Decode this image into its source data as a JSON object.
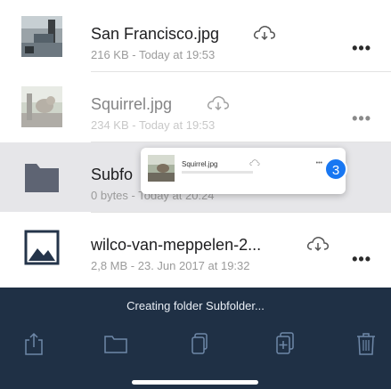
{
  "files": [
    {
      "name": "San Francisco.jpg",
      "meta": "216 KB - Today at 19:53",
      "more": "•••"
    },
    {
      "name": "Squirrel.jpg",
      "meta": "234 KB - Today at 19:53",
      "more": "•••"
    },
    {
      "name": "Subfo",
      "meta": "0 bytes - Today at 20:24",
      "more": "•••"
    },
    {
      "name": "wilco-van-meppelen-2...",
      "meta": "2,8 MB - 23. Jun 2017 at 19:32",
      "more": "•••"
    }
  ],
  "drag_preview": {
    "name": "Squirrel.jpg",
    "more": "•••",
    "badge_count": "3"
  },
  "toolbar": {
    "status": "Creating folder Subfolder..."
  },
  "icons": [
    "image-icon",
    "folder-icon",
    "cloud-download-icon",
    "more-icon",
    "share-icon",
    "copy-icon",
    "add-file-icon",
    "trash-icon"
  ],
  "colors": {
    "toolbar_bg": "#1f3045",
    "badge": "#1877f2",
    "selected_row": "#e6e6e9",
    "folder": "#5e6473"
  }
}
